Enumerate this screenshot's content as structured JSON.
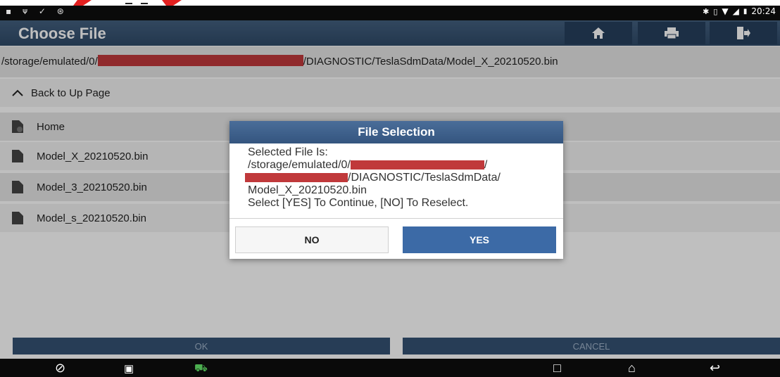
{
  "status_bar": {
    "time": "20:24",
    "left_icons": [
      "gallery-icon",
      "usb-icon",
      "check-icon",
      "debug-icon"
    ],
    "right_icons": [
      "bluetooth-icon",
      "vibrate-icon",
      "wifi-icon",
      "signal-icon",
      "battery-icon"
    ]
  },
  "header": {
    "title": "Choose File",
    "buttons": [
      "home-icon",
      "print-icon",
      "exit-icon"
    ]
  },
  "path": {
    "prefix": "/storage/emulated/0/",
    "suffix": "/DIAGNOSTIC/TeslaSdmData/Model_X_20210520.bin"
  },
  "list": {
    "back_label": "Back to Up Page",
    "items": [
      {
        "label": "Home",
        "icon": "folder-gear-icon"
      },
      {
        "label": "Model_X_20210520.bin",
        "icon": "file-icon"
      },
      {
        "label": "Model_3_20210520.bin",
        "icon": "file-icon"
      },
      {
        "label": "Model_s_20210520.bin",
        "icon": "file-icon"
      }
    ]
  },
  "dialog": {
    "title": "File Selection",
    "line1": "Selected File Is:",
    "line2": "/storage/emulated/0/",
    "line2_end": "/",
    "line3": "/DIAGNOSTIC/TeslaSdmData/",
    "line4": "Model_X_20210520.bin",
    "line5": "Select [YES] To Continue, [NO] To Reselect.",
    "no_label": "NO",
    "yes_label": "YES"
  },
  "footer": {
    "ok_label": "OK",
    "cancel_label": "CANCEL"
  },
  "colors": {
    "header_bg": "#34506f",
    "dialog_title_bg": "#3e6190",
    "yes_button": "#3c6aa6",
    "redaction": "#c0393b"
  }
}
